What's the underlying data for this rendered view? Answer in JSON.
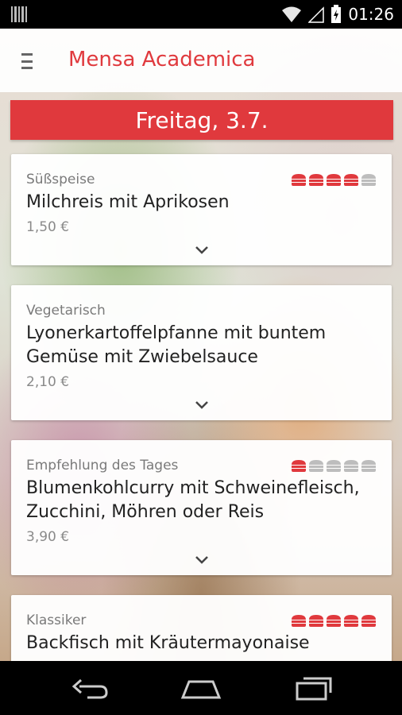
{
  "status": {
    "time": "01:26"
  },
  "app": {
    "title": "Mensa Academica"
  },
  "day": {
    "label": "Freitag, 3.7."
  },
  "colors": {
    "accent": "#e0393d",
    "rating_on": "#e0393d",
    "rating_off": "#bdbdbd"
  },
  "meals": [
    {
      "category": "Süßspeise",
      "dish_lines": [
        "Milchreis mit Aprikosen"
      ],
      "price": "1,50 €",
      "rating": 4,
      "rating_max": 5,
      "show_rating": true
    },
    {
      "category": "Vegetarisch",
      "dish_lines": [
        "Lyonerkartoffelpfanne mit buntem",
        "Gemüse mit Zwiebelsauce"
      ],
      "price": "2,10 €",
      "rating": 0,
      "rating_max": 5,
      "show_rating": false
    },
    {
      "category": "Empfehlung des Tages",
      "dish_lines": [
        "Blumenkohlcurry mit Schweinefleisch,",
        "Zucchini, Möhren oder Reis"
      ],
      "price": "3,90 €",
      "rating": 1,
      "rating_max": 5,
      "show_rating": true
    },
    {
      "category": "Klassiker",
      "dish_lines": [
        "Backfisch mit Kräutermayonaise"
      ],
      "price": "",
      "rating": 5,
      "rating_max": 5,
      "show_rating": true
    }
  ],
  "icons": {
    "menu": "hamburger-menu-icon",
    "expand": "chevron-down-icon",
    "rating": "burger-rating-icon",
    "nav_back": "back-icon",
    "nav_home": "home-icon",
    "nav_recents": "recents-icon"
  }
}
